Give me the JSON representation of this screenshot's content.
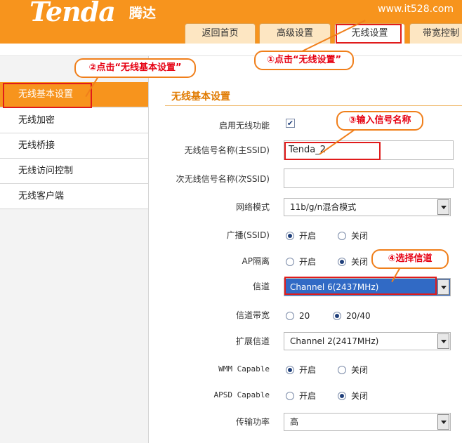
{
  "header": {
    "logo": "Tenda",
    "logo_cn": "腾达",
    "site_url": "www.it528.com",
    "tabs": [
      {
        "label": "返回首页"
      },
      {
        "label": "高级设置"
      },
      {
        "label": "无线设置"
      },
      {
        "label": "带宽控制"
      }
    ],
    "active_tab": "无线设置"
  },
  "sidebar": {
    "items": [
      {
        "label": "无线基本设置"
      },
      {
        "label": "无线加密"
      },
      {
        "label": "无线桥接"
      },
      {
        "label": "无线访问控制"
      },
      {
        "label": "无线客户端"
      }
    ],
    "active": "无线基本设置"
  },
  "form": {
    "title": "无线基本设置",
    "enable_label": "启用无线功能",
    "enable_checked": true,
    "check_mark": "✔",
    "ssid_label": "无线信号名称(主SSID)",
    "ssid_value": "Tenda_2",
    "ssid2_label": "次无线信号名称(次SSID)",
    "ssid2_value": "",
    "mode_label": "网络模式",
    "mode_value": "11b/g/n混合模式",
    "broadcast_label": "广播(SSID)",
    "broadcast_options": [
      "开启",
      "关闭"
    ],
    "broadcast_selected": "开启",
    "ap_isolation_label": "AP隔离",
    "ap_isolation_options": [
      "开启",
      "关闭"
    ],
    "ap_isolation_selected": "关闭",
    "channel_label": "信道",
    "channel_value": "Channel 6(2437MHz)",
    "bandwidth_label": "信道带宽",
    "bandwidth_options": [
      "20",
      "20/40"
    ],
    "bandwidth_selected": "20/40",
    "ext_channel_label": "扩展信道",
    "ext_channel_value": "Channel 2(2417MHz)",
    "wmm_label": "WMM Capable",
    "wmm_options": [
      "开启",
      "关闭"
    ],
    "wmm_selected": "开启",
    "apsd_label": "APSD Capable",
    "apsd_options": [
      "开启",
      "关闭"
    ],
    "apsd_selected": "关闭",
    "power_label": "传输功率",
    "power_value": "高"
  },
  "callouts": {
    "step1": "①点击“无线设置”",
    "step2": "②点击“无线基本设置”",
    "step3": "③输入信号名称",
    "step4": "④选择信道",
    "color": "#e60012",
    "border_color": "#f07f1b"
  },
  "colors": {
    "brand_orange": "#f7941d",
    "highlight_red": "#e01b1b",
    "select_highlight": "#316ac5"
  }
}
